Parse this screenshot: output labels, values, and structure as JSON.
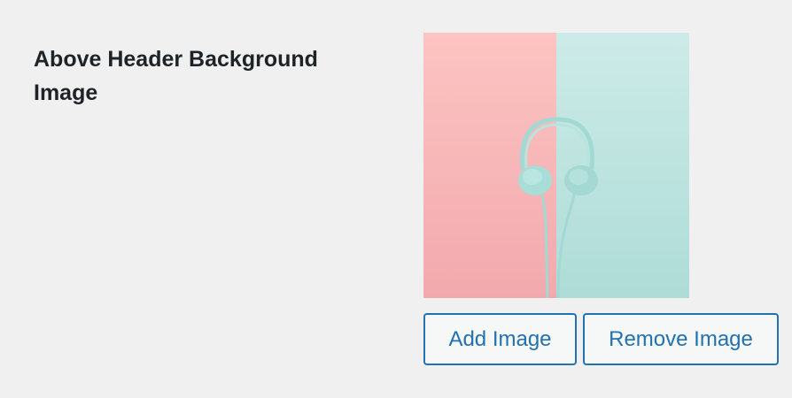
{
  "setting": {
    "label": "Above Header Background Image"
  },
  "preview": {
    "icon": "headphones",
    "colors": {
      "left_background": "#f8b9b9",
      "right_background": "#bfe7e3",
      "headphones": "#a6dcd6"
    }
  },
  "actions": {
    "add_label": "Add Image",
    "remove_label": "Remove Image"
  },
  "theme": {
    "accent": "#2271b1",
    "text": "#1d2327",
    "page_background": "#f0f0f1"
  }
}
